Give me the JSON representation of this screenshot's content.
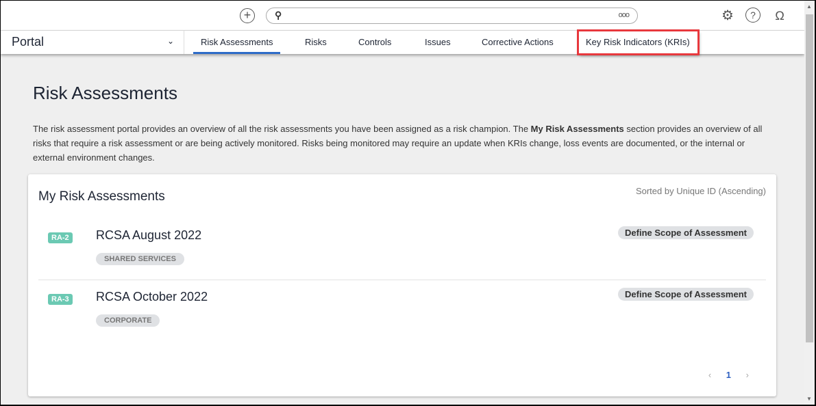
{
  "topbar": {
    "search_options": "ooo"
  },
  "nav": {
    "portal": "Portal",
    "tabs": [
      "Risk Assessments",
      "Risks",
      "Controls",
      "Issues",
      "Corrective Actions",
      "Key Risk Indicators (KRIs)"
    ]
  },
  "page": {
    "title": "Risk Assessments",
    "desc_1": "The risk assessment portal provides an overview of all the risk assessments you have been assigned as a risk champion. The ",
    "desc_bold": "My Risk Assessments",
    "desc_2": " section provides an overview of all risks that require a risk assessment or are being actively monitored. Risks being monitored may require an update when KRIs change, loss events are documented, or the internal or external environment changes."
  },
  "card": {
    "title": "My Risk Assessments",
    "sorted": "Sorted by Unique ID (Ascending)",
    "rows": [
      {
        "id": "RA-2",
        "name": "RCSA August 2022",
        "category": "SHARED SERVICES",
        "status": "Define Scope of Assessment"
      },
      {
        "id": "RA-3",
        "name": "RCSA October 2022",
        "category": "CORPORATE",
        "status": "Define Scope of Assessment"
      }
    ],
    "pager": {
      "prev": "‹",
      "page": "1",
      "next": "›"
    }
  }
}
